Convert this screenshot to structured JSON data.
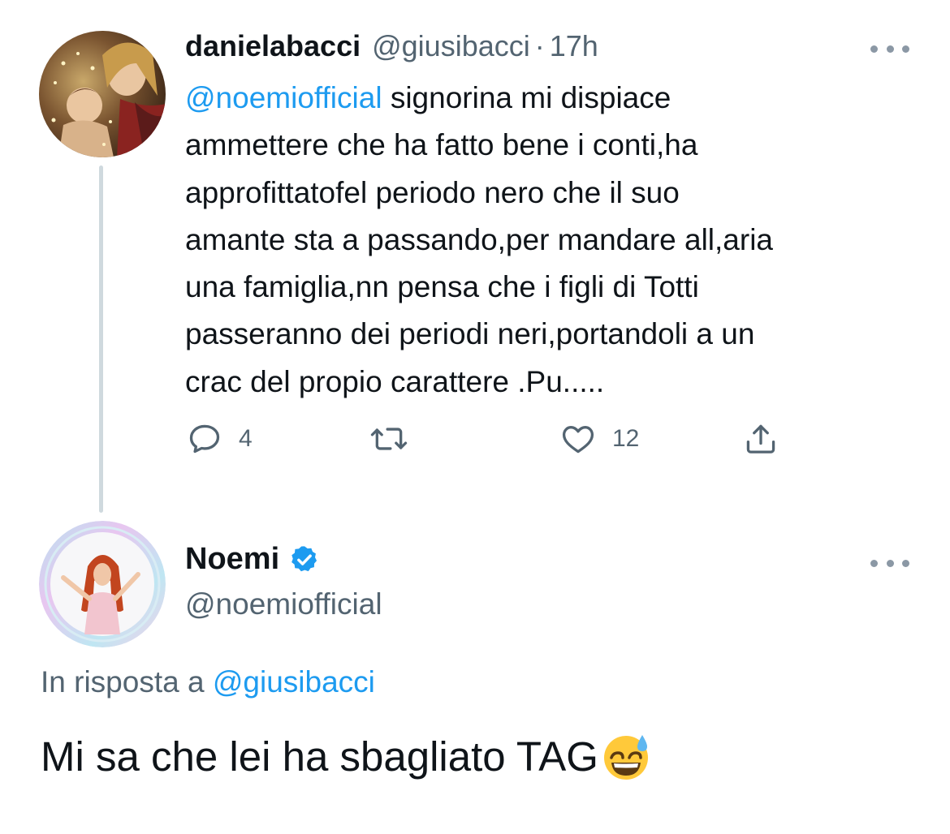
{
  "original_tweet": {
    "display_name": "danielabacci",
    "handle": "@giusibacci",
    "separator": "·",
    "time": "17h",
    "mention": "@noemiofficial",
    "text_lines": [
      " signorina mi dispiace",
      "ammettere che ha fatto bene i conti,ha",
      "approfittatofel periodo nero che il suo",
      "amante sta a passando,per mandare all,aria",
      "una famiglia,nn pensa che i figli di Totti",
      "passeranno dei periodi neri,portandoli a un",
      "crac del propio carattere .Pu....."
    ],
    "actions": {
      "reply_icon": "reply-icon",
      "reply_count": "4",
      "retweet_icon": "retweet-icon",
      "retweet_count": "",
      "like_icon": "heart-icon",
      "like_count": "12",
      "share_icon": "share-icon"
    },
    "more_icon": "more-icon"
  },
  "reply_tweet": {
    "display_name": "Noemi",
    "verified_icon": "verified-badge-icon",
    "handle": "@noemiofficial",
    "in_reply_prefix": "In risposta a ",
    "in_reply_handle": "@giusibacci",
    "text": "Mi sa che lei ha sbagliato TAG",
    "emoji_name": "grinning-face-with-sweat-emoji",
    "more_icon": "more-icon"
  },
  "colors": {
    "text": "#0f1419",
    "secondary": "#536471",
    "link": "#1d9bf0",
    "thread_line": "#cfd9de",
    "verified": "#1d9bf0"
  }
}
